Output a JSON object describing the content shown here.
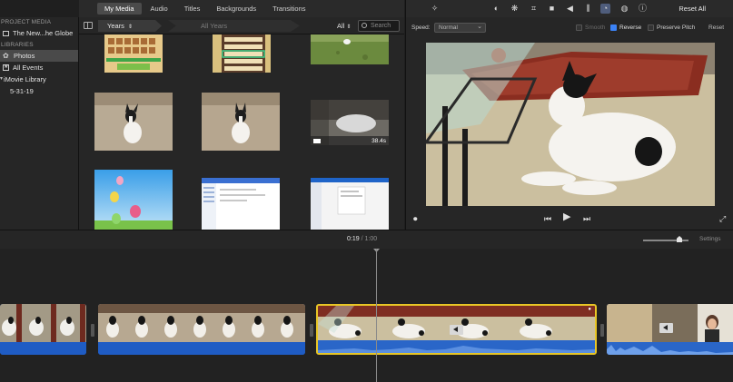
{
  "sidebar": {
    "project_media_heading": "PROJECT MEDIA",
    "project_item": "The New...he Globe",
    "libraries_heading": "LIBRARIES",
    "items": [
      {
        "label": "Photos",
        "icon": "photos-icon",
        "active": true
      },
      {
        "label": "All Events",
        "icon": "star-icon",
        "active": false
      }
    ],
    "library_name": "iMovie Library",
    "event_name": "5-31-19"
  },
  "media_tabs": [
    "My Media",
    "Audio",
    "Titles",
    "Backgrounds",
    "Transitions"
  ],
  "media_tab_active": "My Media",
  "browser": {
    "years_label": "Years",
    "all_years_label": "All Years",
    "filter_label": "All",
    "search_placeholder": "Search"
  },
  "media_grid": {
    "clip_durations": [
      "38.4s"
    ]
  },
  "viewer_toolbar": {
    "tools": [
      "magic-wand-icon",
      "color-balance-icon",
      "color-palette-icon",
      "crop-icon",
      "stabilization-icon",
      "volume-icon",
      "equalizer-icon",
      "speed-icon",
      "filter-icon",
      "info-icon"
    ],
    "active_tool": "speed-icon",
    "reset_all_label": "Reset All"
  },
  "speed_panel": {
    "speed_label": "Speed:",
    "speed_value": "Normal",
    "smooth_label": "Smooth",
    "smooth_checked": false,
    "reverse_label": "Reverse",
    "reverse_checked": true,
    "preserve_pitch_label": "Preserve Pitch",
    "preserve_pitch_checked": false,
    "reset_label": "Reset"
  },
  "timeline": {
    "current_time": "0:19",
    "separator": "/",
    "total_time": "1:00",
    "settings_label": "Settings"
  },
  "colors": {
    "selection": "#e8c626",
    "audio_blue": "#1f5cc4",
    "checkbox_blue": "#3b82f6"
  }
}
